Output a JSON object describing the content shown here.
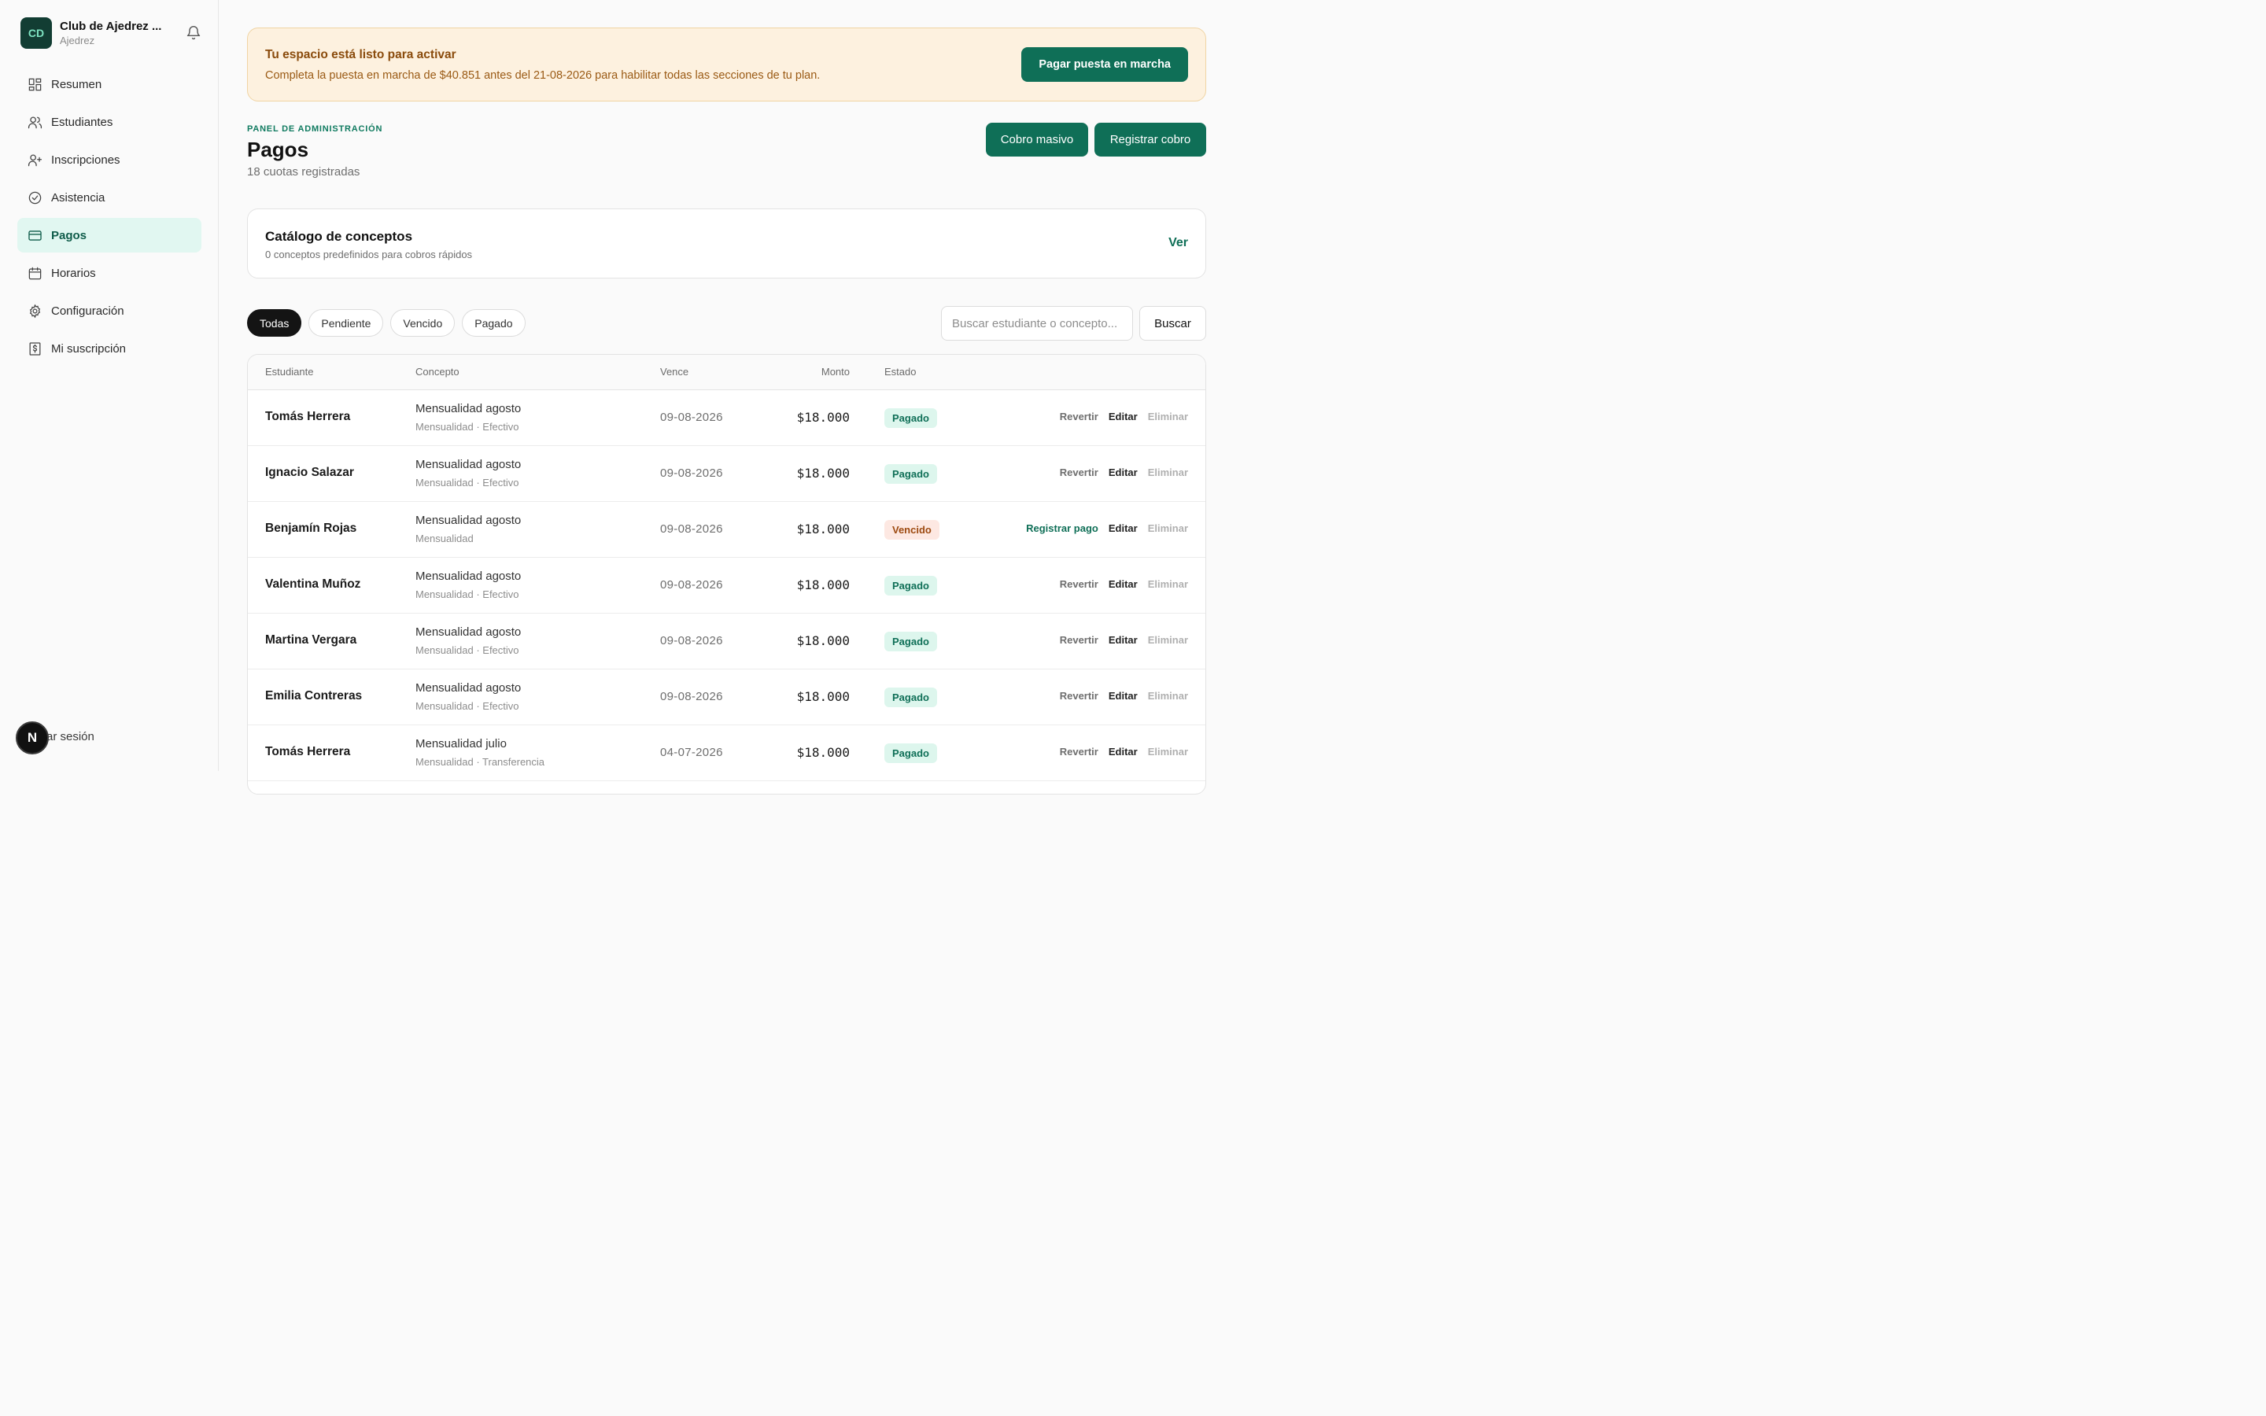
{
  "org": {
    "initials": "CD",
    "name": "Club de Ajedrez ...",
    "sport": "Ajedrez"
  },
  "nav": [
    {
      "label": "Resumen",
      "icon": "dashboard-icon"
    },
    {
      "label": "Estudiantes",
      "icon": "users-icon"
    },
    {
      "label": "Inscripciones",
      "icon": "user-plus-icon"
    },
    {
      "label": "Asistencia",
      "icon": "check-circle-icon"
    },
    {
      "label": "Pagos",
      "icon": "credit-card-icon",
      "active": true
    },
    {
      "label": "Horarios",
      "icon": "calendar-icon"
    },
    {
      "label": "Configuración",
      "icon": "gear-icon"
    },
    {
      "label": "Mi suscripción",
      "icon": "receipt-icon"
    }
  ],
  "logout": {
    "avatar": "N",
    "label": "ar sesión"
  },
  "banner": {
    "title": "Tu espacio está listo para activar",
    "text": "Completa la puesta en marcha de $40.851 antes del 21-08-2026 para habilitar todas las secciones de tu plan.",
    "button": "Pagar puesta en marcha"
  },
  "header": {
    "eyebrow": "PANEL DE ADMINISTRACIÓN",
    "title": "Pagos",
    "subtitle": "18 cuotas registradas",
    "bulk_button": "Cobro masivo",
    "register_button": "Registrar cobro"
  },
  "catalog": {
    "title": "Catálogo de conceptos",
    "subtitle": "0 conceptos predefinidos para cobros rápidos",
    "link": "Ver"
  },
  "filters": [
    "Todas",
    "Pendiente",
    "Vencido",
    "Pagado"
  ],
  "search": {
    "placeholder": "Buscar estudiante o concepto...",
    "button": "Buscar"
  },
  "table": {
    "columns": {
      "student": "Estudiante",
      "concept": "Concepto",
      "due": "Vence",
      "amount": "Monto",
      "status": "Estado"
    },
    "rows": [
      {
        "student": "Tomás Herrera",
        "concept": "Mensualidad agosto",
        "detail": "Mensualidad · Efectivo",
        "due": "09-08-2026",
        "amount": "$18.000",
        "status": "Pagado",
        "primary_action": "Revertir",
        "edit": "Editar",
        "delete": "Eliminar"
      },
      {
        "student": "Ignacio Salazar",
        "concept": "Mensualidad agosto",
        "detail": "Mensualidad · Efectivo",
        "due": "09-08-2026",
        "amount": "$18.000",
        "status": "Pagado",
        "primary_action": "Revertir",
        "edit": "Editar",
        "delete": "Eliminar"
      },
      {
        "student": "Benjamín Rojas",
        "concept": "Mensualidad agosto",
        "detail": "Mensualidad",
        "due": "09-08-2026",
        "amount": "$18.000",
        "status": "Vencido",
        "primary_action": "Registrar pago",
        "edit": "Editar",
        "delete": "Eliminar"
      },
      {
        "student": "Valentina Muñoz",
        "concept": "Mensualidad agosto",
        "detail": "Mensualidad · Efectivo",
        "due": "09-08-2026",
        "amount": "$18.000",
        "status": "Pagado",
        "primary_action": "Revertir",
        "edit": "Editar",
        "delete": "Eliminar"
      },
      {
        "student": "Martina Vergara",
        "concept": "Mensualidad agosto",
        "detail": "Mensualidad · Efectivo",
        "due": "09-08-2026",
        "amount": "$18.000",
        "status": "Pagado",
        "primary_action": "Revertir",
        "edit": "Editar",
        "delete": "Eliminar"
      },
      {
        "student": "Emilia Contreras",
        "concept": "Mensualidad agosto",
        "detail": "Mensualidad · Efectivo",
        "due": "09-08-2026",
        "amount": "$18.000",
        "status": "Pagado",
        "primary_action": "Revertir",
        "edit": "Editar",
        "delete": "Eliminar"
      },
      {
        "student": "Tomás Herrera",
        "concept": "Mensualidad julio",
        "detail": "Mensualidad · Transferencia",
        "due": "04-07-2026",
        "amount": "$18.000",
        "status": "Pagado",
        "primary_action": "Revertir",
        "edit": "Editar",
        "delete": "Eliminar"
      }
    ]
  },
  "colors": {
    "accent": "#0f6f57",
    "active_nav_bg": "#e1f7f1",
    "banner_bg": "#fdf1df",
    "paid_bg": "#ddf6ed",
    "overdue_bg": "#fde8e2"
  }
}
